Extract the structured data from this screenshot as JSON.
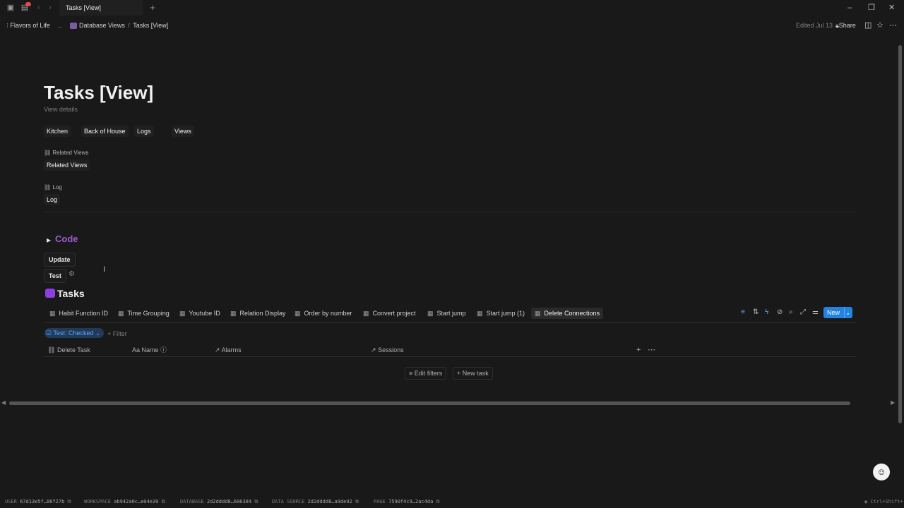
{
  "app": {
    "tab_title": "Tasks [View]",
    "add_tab_symbol": "+",
    "notification_dot": true
  },
  "breadcrumb": {
    "workspace": "Flavors of Life",
    "ellipsis": "...",
    "parent": "Database Views",
    "current": "Tasks [View]"
  },
  "topbar": {
    "edited": "Edited Jul 13",
    "share": "Share"
  },
  "page": {
    "title": "Tasks [View]",
    "subtitle": "View details",
    "nav_buttons": [
      "Kitchen",
      "Back of House",
      "Logs",
      "Views"
    ],
    "related_views_label": "Related Views",
    "related_views_button": "Related Views",
    "log_label": "Log",
    "log_button": "Log",
    "code_toggle": "Code",
    "update_button": "Update",
    "test_button": "Test"
  },
  "database": {
    "title": "Tasks",
    "views": [
      "Habit Function ID",
      "Time Grouping",
      "Youtube ID",
      "Relation Display",
      "Order by number",
      "Convert project",
      "Start jump",
      "Start jump (1)",
      "Delete Connections"
    ],
    "active_view": "Delete Connections",
    "new_button": "New",
    "filter_chip": "Test: Checked",
    "add_filter": "+ Filter",
    "columns": [
      "Delete Task",
      "Name",
      "Alarms",
      "Sessions"
    ],
    "edit_filters": "Edit filters",
    "new_task": "+ New task"
  },
  "footer": {
    "user_label": "USER",
    "user_value": "67d13e5f…86f27b",
    "workspace_label": "WORKSPACE",
    "workspace_value": "ab942a0c…e04e39",
    "database_label": "DATABASE",
    "database_value": "2d2dddd8…606384",
    "datasource_label": "DATA SOURCE",
    "datasource_value": "2d2dddd8…a9de92",
    "page_label": "PAGE",
    "page_value": "7590f4c9…2ac4da",
    "shortcut": "Ctrl+Shift+"
  },
  "icons": {
    "sidebar": "sidebar-icon",
    "back": "back-arrow-icon",
    "forward": "forward-arrow-icon",
    "share": "lock-icon",
    "star": "star-icon",
    "more": "more-icon"
  },
  "colors": {
    "background": "#191919",
    "accent": "#2383e2",
    "code_purple": "#9d5bd2",
    "tasks_icon": "#8b3fe0"
  }
}
